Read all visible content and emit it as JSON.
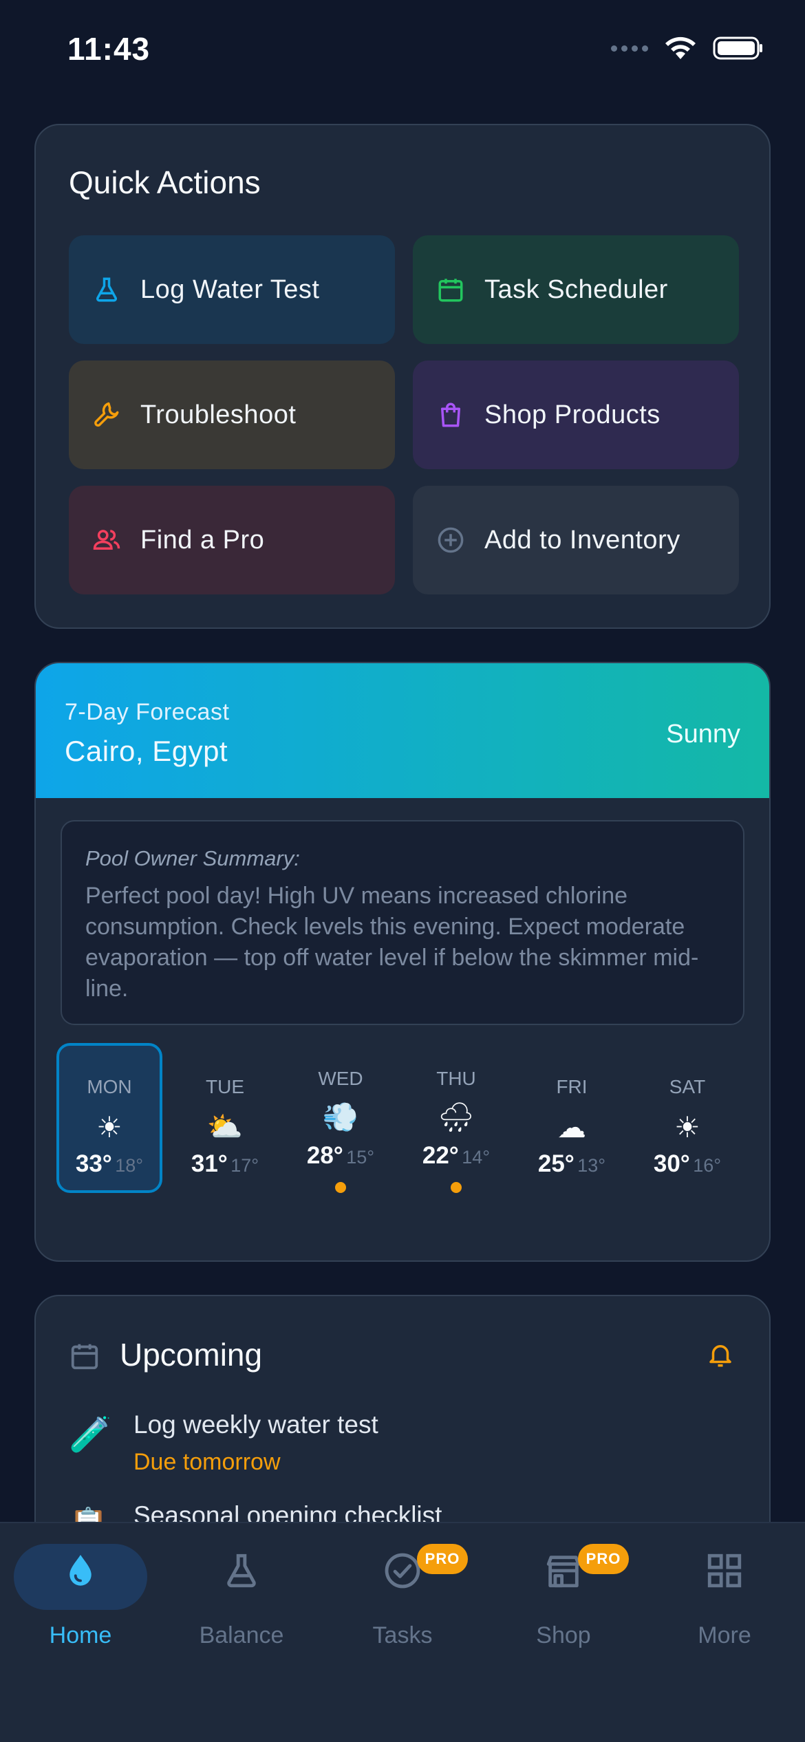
{
  "status": {
    "time": "11:43"
  },
  "quick_actions": {
    "title": "Quick Actions",
    "items": [
      {
        "label": "Log Water Test",
        "icon": "flask-icon",
        "bg": "#1a3650",
        "accent": "#0ea5e9"
      },
      {
        "label": "Task Scheduler",
        "icon": "calendar-icon",
        "bg": "#1a3d3a",
        "accent": "#22c55e"
      },
      {
        "label": "Troubleshoot",
        "icon": "wrench-icon",
        "bg": "#3a3935",
        "accent": "#f59e0b"
      },
      {
        "label": "Shop Products",
        "icon": "shopping-bag-icon",
        "bg": "#2f2a50",
        "accent": "#a855f7"
      },
      {
        "label": "Find a Pro",
        "icon": "people-icon",
        "bg": "#3a2838",
        "accent": "#f43f5e"
      },
      {
        "label": "Add to Inventory",
        "icon": "plus-circle-icon",
        "bg": "#2a3444",
        "accent": "#64748b"
      }
    ]
  },
  "forecast": {
    "subtitle": "7-Day Forecast",
    "location": "Cairo, Egypt",
    "condition": "Sunny",
    "summary_title": "Pool Owner Summary:",
    "summary_text": "Perfect pool day! High UV means increased chlorine consumption. Check levels this evening. Expect moderate evaporation — top off water level if below the skimmer mid-line.",
    "days": [
      {
        "name": "MON",
        "icon": "☀",
        "hi": "33°",
        "lo": "18°",
        "active": true,
        "alert": false
      },
      {
        "name": "TUE",
        "icon": "⛅",
        "hi": "31°",
        "lo": "17°",
        "active": false,
        "alert": false
      },
      {
        "name": "WED",
        "icon": "💨",
        "hi": "28°",
        "lo": "15°",
        "active": false,
        "alert": true
      },
      {
        "name": "THU",
        "icon": "🌧",
        "hi": "22°",
        "lo": "14°",
        "active": false,
        "alert": true
      },
      {
        "name": "FRI",
        "icon": "☁",
        "hi": "25°",
        "lo": "13°",
        "active": false,
        "alert": false
      },
      {
        "name": "SAT",
        "icon": "☀",
        "hi": "30°",
        "lo": "16°",
        "active": false,
        "alert": false
      }
    ]
  },
  "upcoming": {
    "title": "Upcoming",
    "items": [
      {
        "title": "Log weekly water test",
        "due": "Due tomorrow",
        "icon": "🧪"
      },
      {
        "title": "Seasonal opening checklist",
        "due": "",
        "icon": "📋"
      }
    ]
  },
  "tabs": [
    {
      "label": "Home",
      "icon": "water-drop-icon",
      "active": true,
      "pro": false
    },
    {
      "label": "Balance",
      "icon": "flask-icon",
      "active": false,
      "pro": false
    },
    {
      "label": "Tasks",
      "icon": "check-circle-icon",
      "active": false,
      "pro": true
    },
    {
      "label": "Shop",
      "icon": "store-icon",
      "active": false,
      "pro": true
    },
    {
      "label": "More",
      "icon": "grid-icon",
      "active": false,
      "pro": false
    }
  ],
  "pro_badge": "PRO"
}
